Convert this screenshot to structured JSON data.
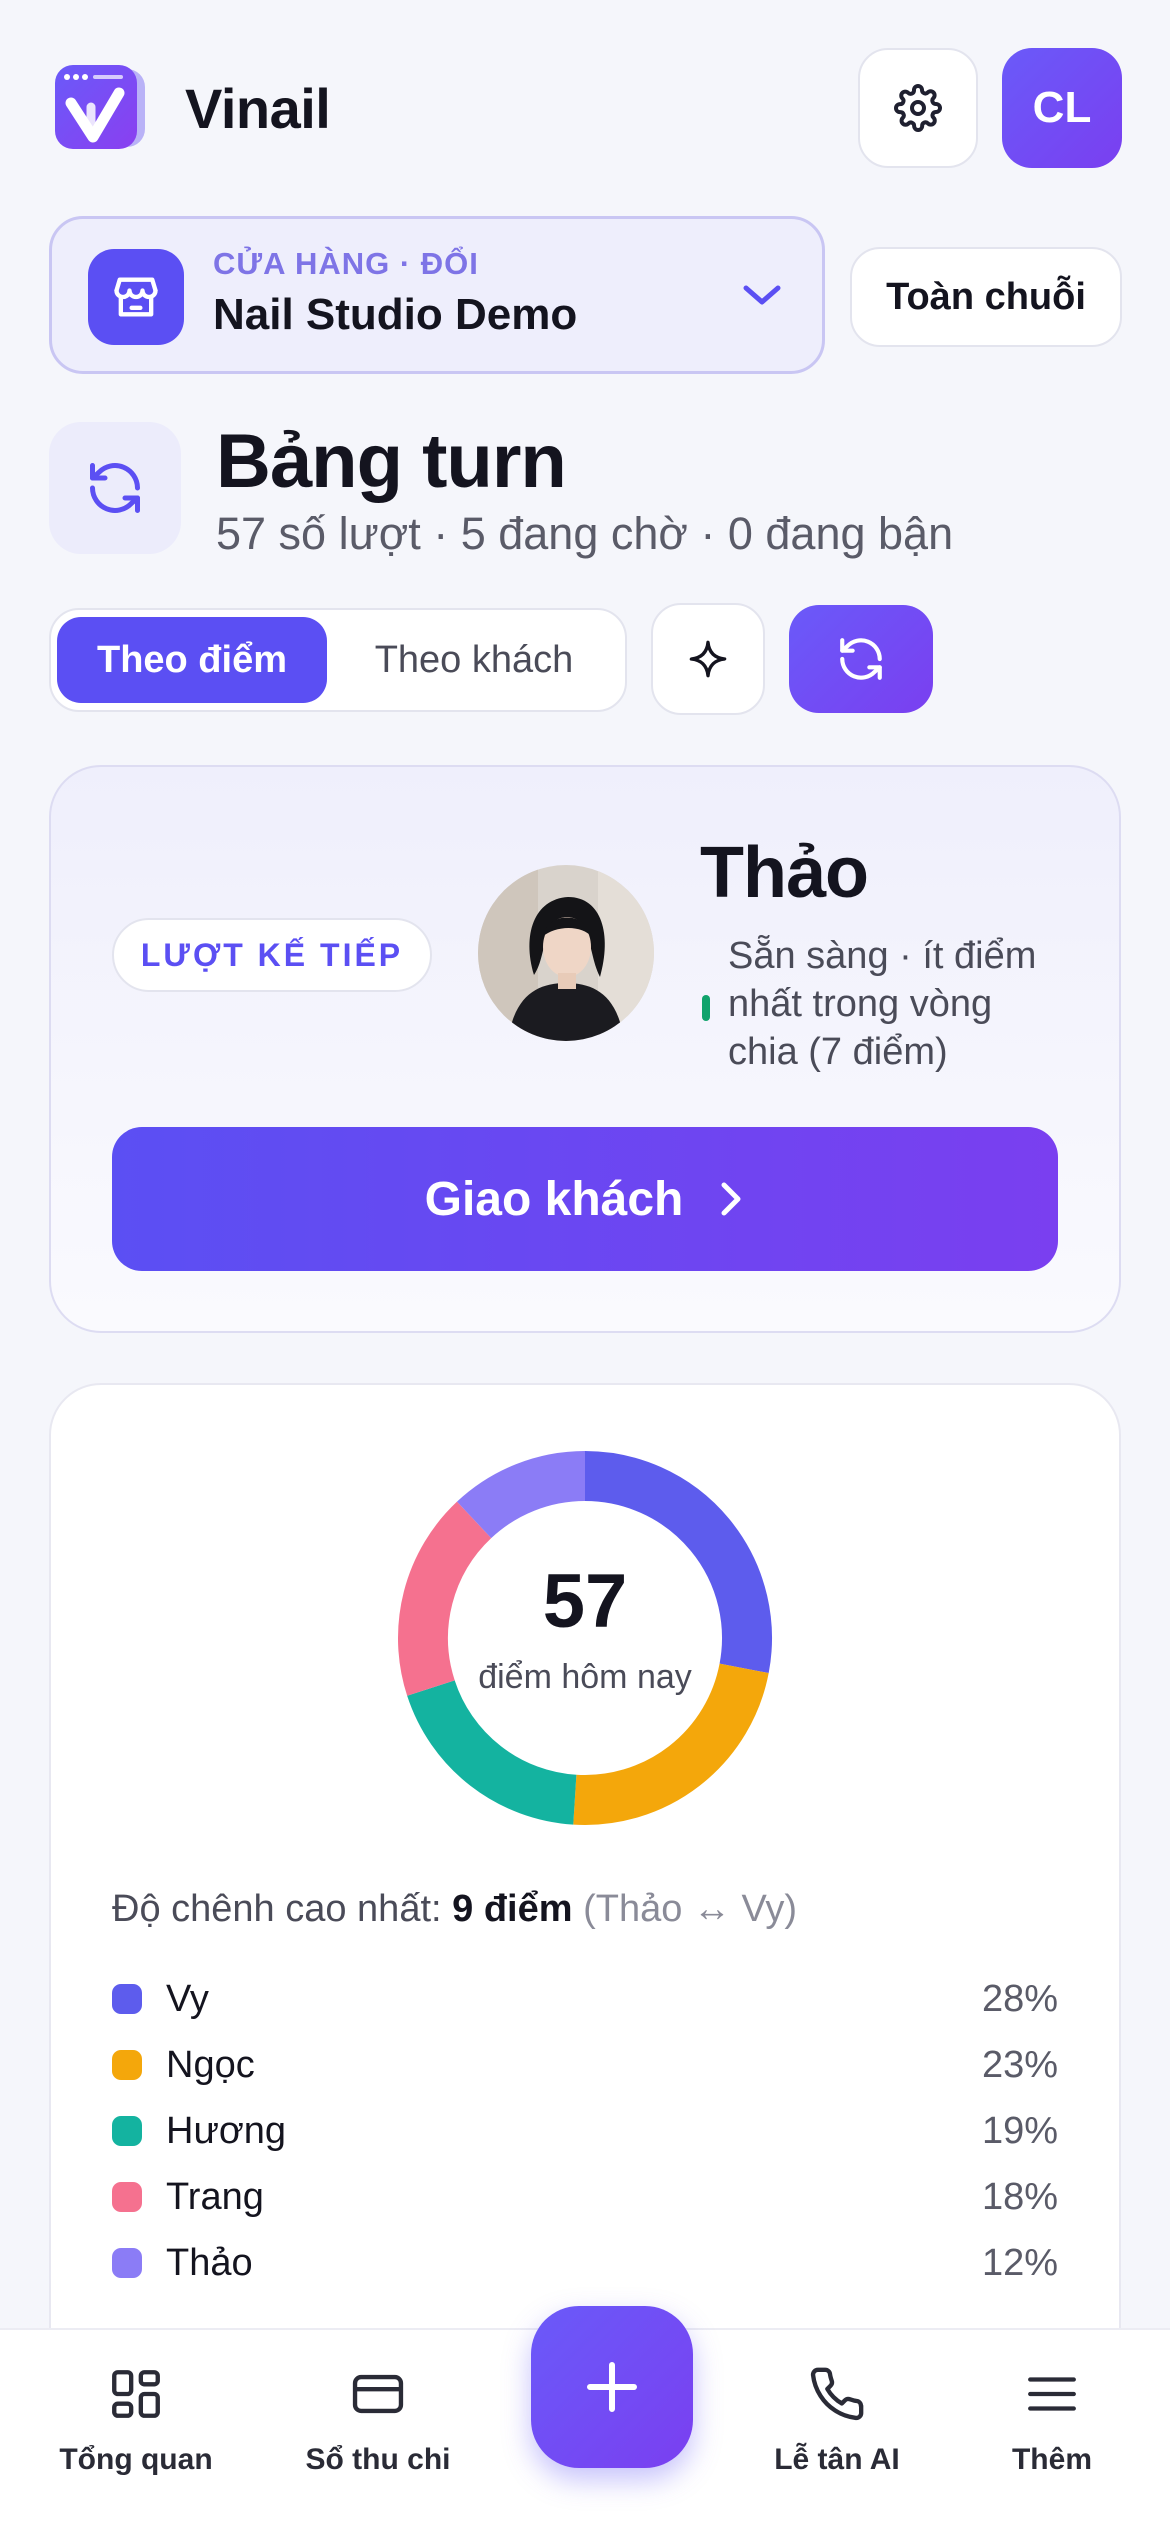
{
  "app": {
    "title": "Vinail",
    "avatar_initials": "CL"
  },
  "store": {
    "kicker": "CỬA HÀNG · ĐỔI",
    "name": "Nail Studio Demo",
    "chain_button": "Toàn chuỗi"
  },
  "page": {
    "title": "Bảng turn",
    "subtitle": "57 số lượt · 5 đang chờ · 0 đang bận"
  },
  "segment": {
    "active": "Theo điểm",
    "inactive": "Theo khách"
  },
  "next_turn": {
    "label": "LƯỢT KẾ TIẾP",
    "name": "Thảo",
    "status": "Sẵn sàng · ít điểm nhất trong vòng chia (7 điểm)",
    "status_color": "#10a36c",
    "assign_button": "Giao khách"
  },
  "points": {
    "total": "57",
    "caption": "điểm hôm nay",
    "gap_prefix": "Độ chênh cao nhất: ",
    "gap_value": "9 điểm",
    "gap_pair": "(Thảo ↔ Vy)"
  },
  "chart_data": {
    "type": "pie",
    "categories": [
      "Vy",
      "Ngọc",
      "Hương",
      "Trang",
      "Thảo"
    ],
    "values": [
      28,
      23,
      19,
      18,
      12
    ],
    "labels": [
      "28%",
      "23%",
      "19%",
      "18%",
      "12%"
    ],
    "colors": [
      "#5d5ced",
      "#f4a70b",
      "#14b3a0",
      "#f5718f",
      "#8b7cf6"
    ]
  },
  "nav": {
    "overview": "Tổng quan",
    "ledger": "Sổ thu chi",
    "ai_reception": "Lễ tân AI",
    "more": "Thêm"
  },
  "colors": {
    "accent": "#5b4ff3",
    "accent_end": "#7a3ff0",
    "background": "#f5f6fb"
  }
}
